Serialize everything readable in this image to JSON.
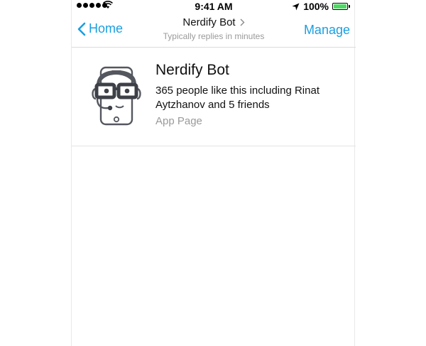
{
  "status_bar": {
    "time": "9:41 AM",
    "battery_percent": "100%",
    "battery_level": 1.0,
    "location_icon": "location-arrow-icon",
    "wifi_icon": "wifi-icon",
    "signal_icon": "signal-dots-icon"
  },
  "nav": {
    "back_label": "Home",
    "back_icon": "chevron-left-icon",
    "title": "Nerdify Bot",
    "title_icon": "chevron-right-icon",
    "subtitle": "Typically replies in minutes",
    "manage_label": "Manage"
  },
  "page_card": {
    "name": "Nerdify Bot",
    "likes_text": "365 people like this including Rinat Aytzhanov and 5 friends",
    "page_type": "App Page",
    "avatar_icon": "nerd-phone-avatar-icon"
  },
  "colors": {
    "accent": "#1a9fe0",
    "secondary_text": "#9a9a9a",
    "battery_fill": "#4cd964"
  }
}
